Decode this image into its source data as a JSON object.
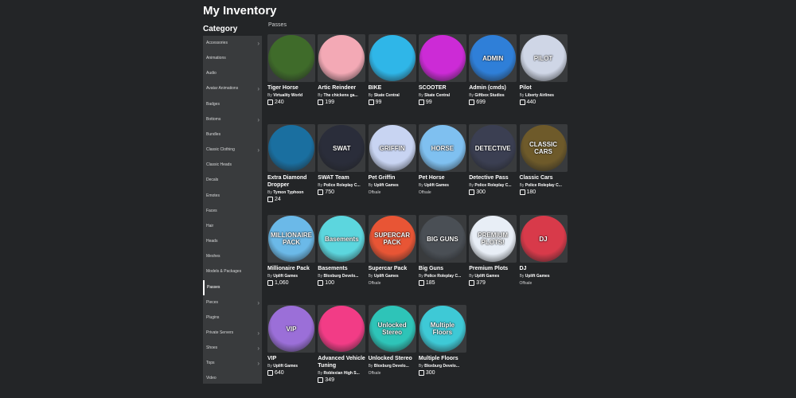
{
  "page_title": "My Inventory",
  "category_title": "Category",
  "section_label": "Passes",
  "by_prefix": "By",
  "categories": [
    {
      "label": "Accessories",
      "chevron": true
    },
    {
      "label": "Animations",
      "chevron": false
    },
    {
      "label": "Audio",
      "chevron": false
    },
    {
      "label": "Avatar Animations",
      "chevron": true
    },
    {
      "label": "Badges",
      "chevron": false
    },
    {
      "label": "Bottoms",
      "chevron": true
    },
    {
      "label": "Bundles",
      "chevron": false
    },
    {
      "label": "Classic Clothing",
      "chevron": true
    },
    {
      "label": "Classic Heads",
      "chevron": false
    },
    {
      "label": "Decals",
      "chevron": false
    },
    {
      "label": "Emotes",
      "chevron": false
    },
    {
      "label": "Faces",
      "chevron": false
    },
    {
      "label": "Hair",
      "chevron": false
    },
    {
      "label": "Heads",
      "chevron": false
    },
    {
      "label": "Meshes",
      "chevron": false
    },
    {
      "label": "Models & Packages",
      "chevron": false
    },
    {
      "label": "Passes",
      "chevron": false,
      "active": true
    },
    {
      "label": "Pieces",
      "chevron": true
    },
    {
      "label": "Plugins",
      "chevron": false
    },
    {
      "label": "Private Servers",
      "chevron": true
    },
    {
      "label": "Shoes",
      "chevron": true
    },
    {
      "label": "Tops",
      "chevron": true
    },
    {
      "label": "Video",
      "chevron": false
    }
  ],
  "items": [
    {
      "name": "Tiger Horse",
      "creator": "Virtuality World",
      "price": "240",
      "bg": "#3f6b2a",
      "thumb_text": ""
    },
    {
      "name": "Artic Reindeer",
      "creator": "The chickens ga...",
      "price": "199",
      "bg": "#f3a9b5",
      "thumb_text": ""
    },
    {
      "name": "BIKE",
      "creator": "Skate Central",
      "price": "99",
      "bg": "#2fb6e8",
      "thumb_text": ""
    },
    {
      "name": "SCOOTER",
      "creator": "Skate Central",
      "price": "99",
      "bg": "#cc2bd6",
      "thumb_text": ""
    },
    {
      "name": "Admin (cmds)",
      "creator": "Giftbox Studios",
      "price": "699",
      "bg": "#2f7fd8",
      "thumb_text": "ADMIN"
    },
    {
      "name": "Pilot",
      "creator": "Liberty Airlines",
      "price": "440",
      "bg": "#cfd6e6",
      "thumb_text": "PILOT"
    },
    {
      "name": "Extra Diamond Dropper",
      "creator": "Tymon Typhoon",
      "price": "24",
      "bg": "#1a6fa0",
      "thumb_text": ""
    },
    {
      "name": "SWAT Team",
      "creator": "Police Roleplay C...",
      "price": "750",
      "bg": "#2a2d3a",
      "thumb_text": "SWAT"
    },
    {
      "name": "Pet Griffin",
      "creator": "Uplift Games",
      "offsale": "Offsale",
      "bg": "#c8d4f2",
      "thumb_text": "GRIFFIN"
    },
    {
      "name": "Pet Horse",
      "creator": "Uplift Games",
      "offsale": "Offsale",
      "bg": "#7fc0f0",
      "thumb_text": "HORSE"
    },
    {
      "name": "Detective Pass",
      "creator": "Police Roleplay C...",
      "price": "300",
      "bg": "#3b3f52",
      "thumb_text": "DETECTIVE"
    },
    {
      "name": "Classic Cars",
      "creator": "Police Roleplay C...",
      "price": "180",
      "bg": "#6e5a2a",
      "thumb_text": "CLASSIC CARS"
    },
    {
      "name": "Millionaire Pack",
      "creator": "Uplift Games",
      "price": "1,060",
      "bg": "#6bb9e8",
      "thumb_text": "MILLIONAIRE PACK"
    },
    {
      "name": "Basements",
      "creator": "Bloxburg Develo...",
      "price": "100",
      "bg": "#5cd6de",
      "thumb_text": "Basements"
    },
    {
      "name": "Supercar Pack",
      "creator": "Uplift Games",
      "offsale": "Offsale",
      "bg": "#e85535",
      "thumb_text": "SUPERCAR PACK"
    },
    {
      "name": "Big Guns",
      "creator": "Police Roleplay C...",
      "price": "185",
      "bg": "#4a4f55",
      "thumb_text": "BIG GUNS"
    },
    {
      "name": "Premium Plots",
      "creator": "Uplift Games",
      "price": "379",
      "bg": "#e8eef6",
      "thumb_text": "PREMIUM PLOTS!"
    },
    {
      "name": "DJ",
      "creator": "Uplift Games",
      "offsale": "Offsale",
      "bg": "#d83a4a",
      "thumb_text": "DJ"
    },
    {
      "name": "VIP",
      "creator": "Uplift Games",
      "price": "640",
      "bg": "#9b6fd8",
      "thumb_text": "VIP"
    },
    {
      "name": "Advanced Vehicle Tuning",
      "creator": "Roblexian High S...",
      "price": "349",
      "bg": "#f23c86",
      "thumb_text": ""
    },
    {
      "name": "Unlocked Stereo",
      "creator": "Bloxburg Develo...",
      "offsale": "Offsale",
      "bg": "#2ec4b8",
      "thumb_text": "Unlocked Stereo"
    },
    {
      "name": "Multiple Floors",
      "creator": "Bloxburg Develo...",
      "price": "300",
      "bg": "#3ec9d6",
      "thumb_text": "Multiple Floors"
    }
  ]
}
